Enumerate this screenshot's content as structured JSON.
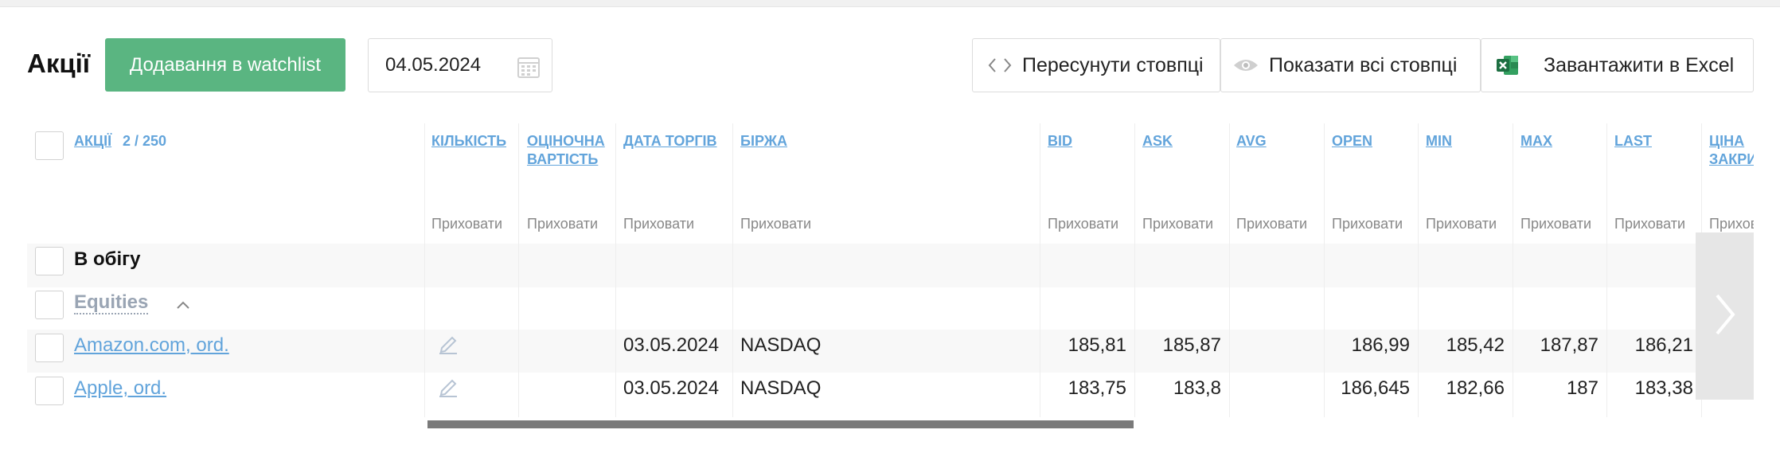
{
  "header": {
    "title": "Акції",
    "add_watchlist_label": "Додавання в watchlist",
    "date_value": "04.05.2024",
    "move_columns_label": "Пересунути стовпці",
    "show_columns_label": "Показати всі стовпці",
    "export_excel_label": "Завантажити в Excel"
  },
  "table": {
    "title_column": {
      "label": "Акції",
      "count": "2 / 250"
    },
    "columns": [
      {
        "key": "qty",
        "label": "Кількість",
        "hide": "Приховати"
      },
      {
        "key": "valuation",
        "label": "Оціночна вартість",
        "hide": "Приховати"
      },
      {
        "key": "trade_date",
        "label": "Дата торгів",
        "hide": "Приховати"
      },
      {
        "key": "exchange",
        "label": "Біржа",
        "hide": "Приховати"
      },
      {
        "key": "bid",
        "label": "BID",
        "hide": "Приховати"
      },
      {
        "key": "ask",
        "label": "ASK",
        "hide": "Приховати"
      },
      {
        "key": "avg",
        "label": "AVG",
        "hide": "Приховати"
      },
      {
        "key": "open",
        "label": "OPEN",
        "hide": "Приховати"
      },
      {
        "key": "min",
        "label": "MIN",
        "hide": "Приховати"
      },
      {
        "key": "max",
        "label": "MAX",
        "hide": "Приховати"
      },
      {
        "key": "last",
        "label": "LAST",
        "hide": "Приховати"
      },
      {
        "key": "close",
        "label": "Ціна закриття",
        "hide": "Приховати"
      }
    ],
    "group": "В обігу",
    "subgroup": "Equities",
    "rows": [
      {
        "name": "Amazon.com, ord.",
        "trade_date": "03.05.2024",
        "exchange": "NASDAQ",
        "bid": "185,81",
        "ask": "185,87",
        "avg": "",
        "open": "186,99",
        "min": "185,42",
        "max": "187,87",
        "last": "186,21"
      },
      {
        "name": "Apple, ord.",
        "trade_date": "03.05.2024",
        "exchange": "NASDAQ",
        "bid": "183,75",
        "ask": "183,8",
        "avg": "",
        "open": "186,645",
        "min": "182,66",
        "max": "187",
        "last": "183,38"
      }
    ]
  },
  "colors": {
    "accent_green": "#5ab581",
    "link_blue": "#62a4db"
  },
  "icons": [
    "calendar-icon",
    "code-arrows-icon",
    "eye-icon",
    "excel-icon",
    "chevron-up-icon",
    "edit-pencil-icon",
    "chevron-right-icon"
  ]
}
